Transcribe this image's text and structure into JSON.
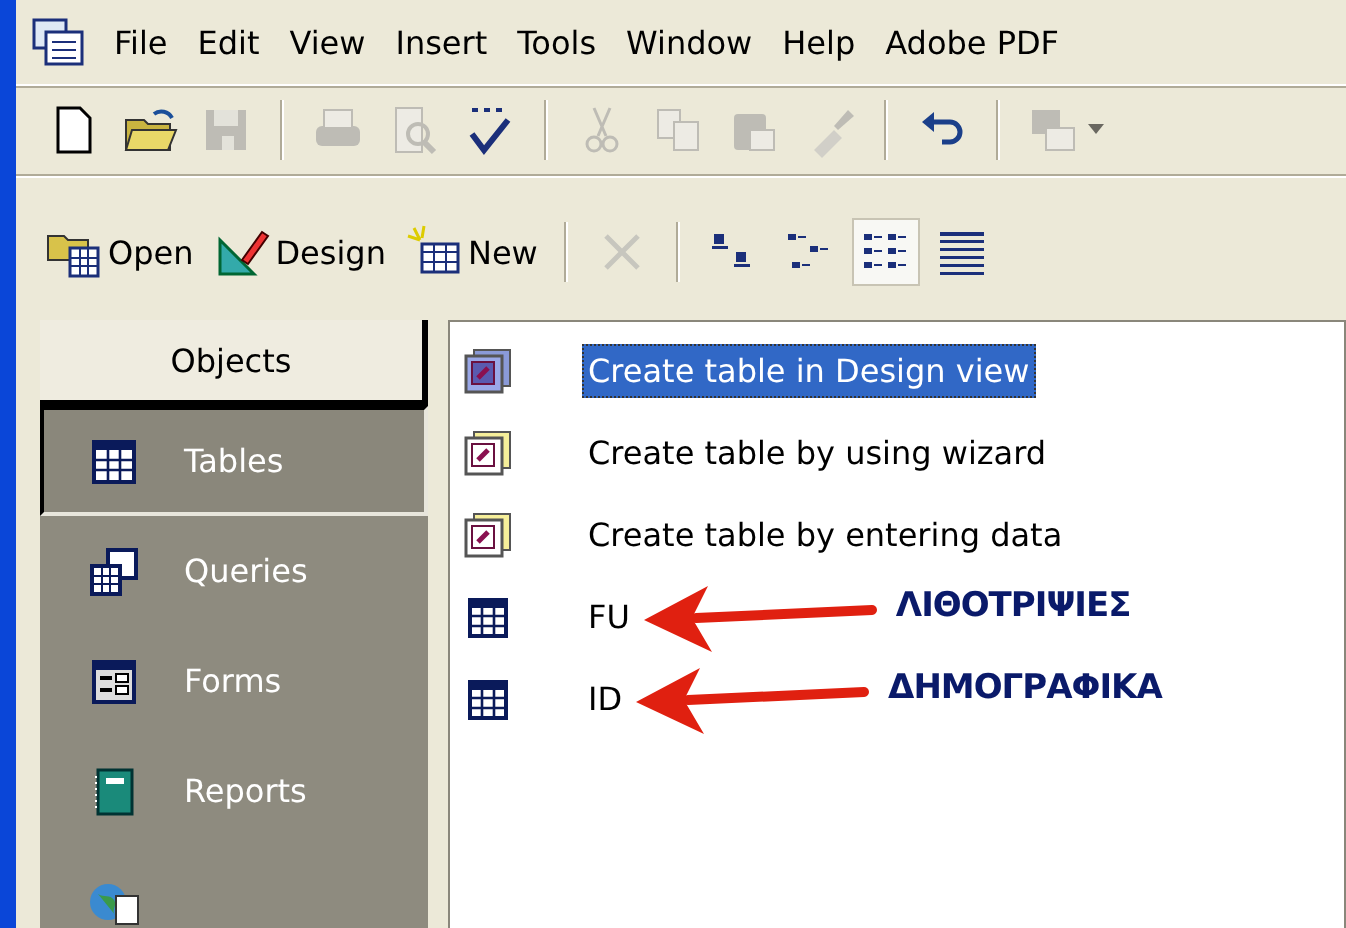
{
  "menu": [
    {
      "label": "File"
    },
    {
      "label": "Edit"
    },
    {
      "label": "View"
    },
    {
      "label": "Insert"
    },
    {
      "label": "Tools"
    },
    {
      "label": "Window"
    },
    {
      "label": "Help"
    },
    {
      "label": "Adobe PDF"
    }
  ],
  "toolbar": [
    {
      "kind": "new",
      "disabled": false
    },
    {
      "kind": "open",
      "disabled": false
    },
    {
      "kind": "save",
      "disabled": true
    },
    {
      "kind": "separator"
    },
    {
      "kind": "print",
      "disabled": true
    },
    {
      "kind": "preview",
      "disabled": true
    },
    {
      "kind": "spelling",
      "disabled": false
    },
    {
      "kind": "separator"
    },
    {
      "kind": "cut",
      "disabled": true
    },
    {
      "kind": "copy",
      "disabled": true
    },
    {
      "kind": "paste",
      "disabled": true
    },
    {
      "kind": "painter",
      "disabled": true
    },
    {
      "kind": "separator"
    },
    {
      "kind": "undo",
      "disabled": false
    },
    {
      "kind": "separator"
    },
    {
      "kind": "office-links",
      "disabled": true
    }
  ],
  "object_toolbar": [
    {
      "kind": "open",
      "label": "Open"
    },
    {
      "kind": "design",
      "label": "Design"
    },
    {
      "kind": "new",
      "label": "New"
    },
    {
      "kind": "separator"
    },
    {
      "kind": "delete",
      "disabled": true
    },
    {
      "kind": "separator"
    },
    {
      "kind": "large-icons",
      "selected": false
    },
    {
      "kind": "small-icons",
      "selected": false
    },
    {
      "kind": "list",
      "selected": true
    },
    {
      "kind": "details",
      "selected": false
    }
  ],
  "objects": {
    "header": "Objects",
    "items": [
      {
        "kind": "tables",
        "label": "Tables",
        "selected": true
      },
      {
        "kind": "queries",
        "label": "Queries",
        "selected": false
      },
      {
        "kind": "forms",
        "label": "Forms",
        "selected": false
      },
      {
        "kind": "reports",
        "label": "Reports",
        "selected": false
      },
      {
        "kind": "pages",
        "selected": false
      }
    ]
  },
  "list": [
    {
      "kind": "shortcut",
      "label": "Create table in Design view",
      "selected": true
    },
    {
      "kind": "shortcut",
      "label": "Create table by using wizard",
      "selected": false
    },
    {
      "kind": "shortcut",
      "label": "Create table by entering data",
      "selected": false
    },
    {
      "kind": "table",
      "label": "FU",
      "selected": false,
      "annotation": "ΛΙΘΟΤΡΙΨΙΕΣ"
    },
    {
      "kind": "table",
      "label": "ID",
      "selected": false,
      "annotation": "ΔΗΜΟΓΡΑΦΙΚΑ"
    }
  ]
}
